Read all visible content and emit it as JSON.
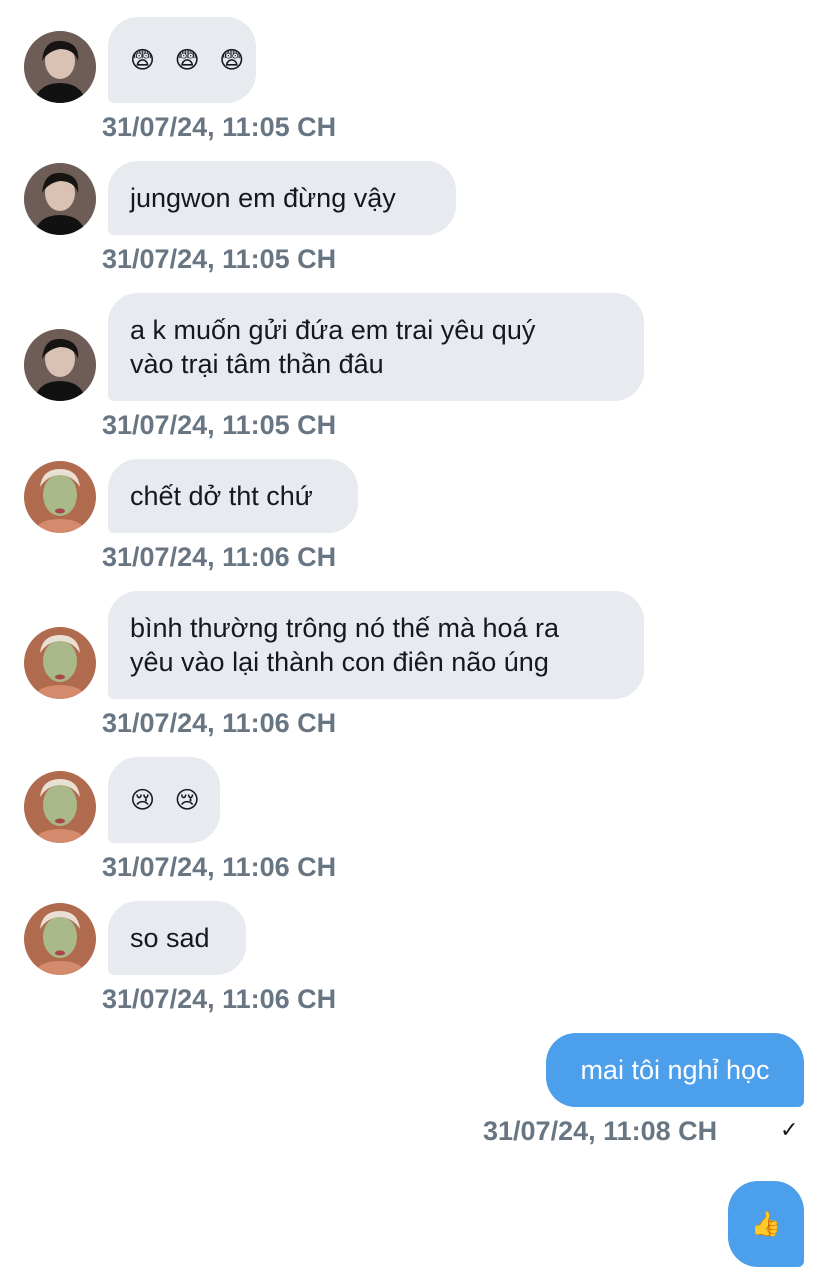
{
  "messages": [
    {
      "sender": "other-a",
      "text": "😨 😨 😨",
      "timestamp": "31/07/24, 11:05 CH"
    },
    {
      "sender": "other-a",
      "text": "jungwon em đừng vậy",
      "timestamp": "31/07/24, 11:05 CH"
    },
    {
      "sender": "other-a",
      "lines": [
        "a k muốn gửi đứa em trai yêu quý",
        "vào trại tâm thần đâu"
      ],
      "timestamp": "31/07/24, 11:05 CH"
    },
    {
      "sender": "other-b",
      "text": "chết dở tht chứ",
      "timestamp": "31/07/24, 11:06 CH"
    },
    {
      "sender": "other-b",
      "lines": [
        "bình thường trông nó thế mà hoá ra",
        "yêu vào lại thành con điên não úng"
      ],
      "timestamp": "31/07/24, 11:06 CH"
    },
    {
      "sender": "other-b",
      "text": "😢 😢",
      "timestamp": "31/07/24, 11:06 CH"
    },
    {
      "sender": "other-b",
      "text": "so sad",
      "timestamp": "31/07/24, 11:06 CH"
    },
    {
      "sender": "me",
      "text": "mai tôi nghỉ học",
      "timestamp": "31/07/24, 11:08 CH",
      "status_icon": "check-icon"
    },
    {
      "sender": "me",
      "text": "👍"
    }
  ],
  "colors": {
    "incoming_bubble": "#e7ebef",
    "outgoing_bubble": "#4c9fea",
    "timestamp": "#687683",
    "text": "#15191e"
  }
}
